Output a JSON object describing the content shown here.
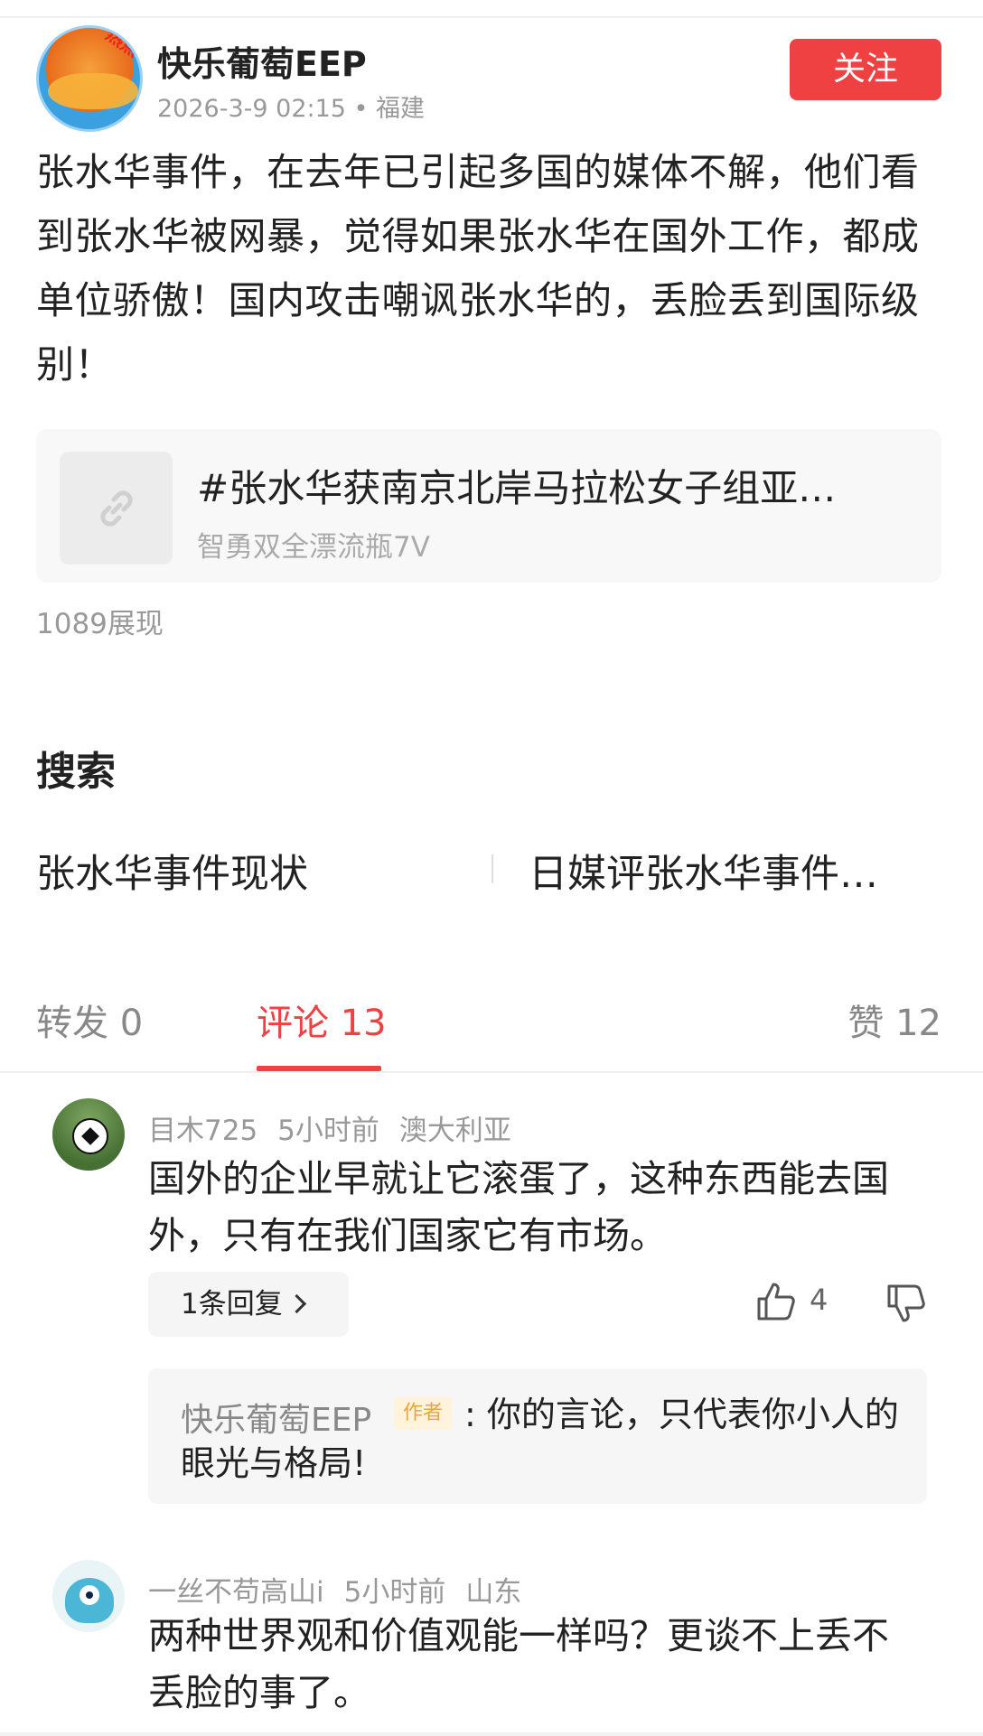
{
  "post": {
    "author": "快乐葡萄EEP",
    "avatar_badge": "热点",
    "meta": "2026-3-9 02:15 • 福建",
    "follow_label": "关注",
    "content": "张水华事件，在去年已引起多国的媒体不解，他们看到张水华被网暴，觉得如果张水华在国外工作，都成单位骄傲！国内攻击嘲讽张水华的，丢脸丢到国际级别！",
    "link_card": {
      "title": "#张水华获南京北岸马拉松女子组亚…",
      "source": "智勇双全漂流瓶7V",
      "icon": "link-icon"
    },
    "views": "1089展现"
  },
  "search": {
    "title": "搜索",
    "items": [
      "张水华事件现状",
      "日媒评张水华事件…"
    ]
  },
  "tabs": {
    "repost": "转发 0",
    "comment": "评论 13",
    "like": "赞 12"
  },
  "comments": [
    {
      "username": "目木725",
      "time": "5小时前",
      "location": "澳大利亚",
      "text": "国外的企业早就让它滚蛋了，这种东西能去国外，只有在我们国家它有市场。",
      "replies_label": "1条回复",
      "likes": "4",
      "reply": {
        "name": "快乐葡萄EEP",
        "tag": "作者",
        "text": ": 你的言论，只代表你小人的眼光与格局!"
      }
    },
    {
      "username": "一丝不苟高山i",
      "time": "5小时前",
      "location": "山东",
      "text": "两种世界观和价值观能一样吗？更谈不上丢不丢脸的事了。"
    }
  ],
  "colors": {
    "accent": "#f04142",
    "muted": "#999999",
    "author_tag_bg": "#fff3dc",
    "author_tag_text": "#e8a640"
  }
}
